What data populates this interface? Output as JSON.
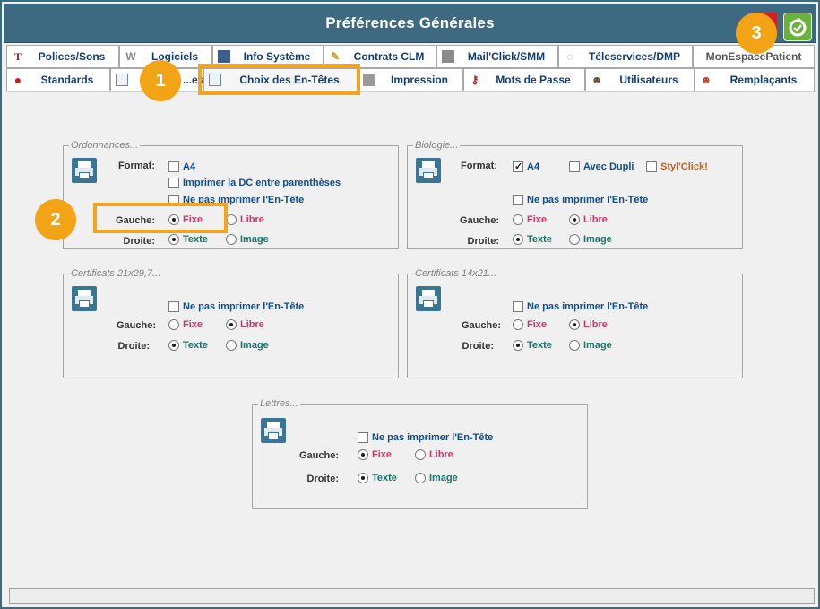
{
  "window": {
    "title": "Préférences Générales"
  },
  "tabs_row1": [
    {
      "label": "Polices/Sons",
      "icon": "font-icon"
    },
    {
      "label": "Logiciels",
      "icon": "logiciels-icon"
    },
    {
      "label": "Info Système",
      "icon": "system-info-icon"
    },
    {
      "label": "Contrats CLM",
      "icon": "pencil-icon"
    },
    {
      "label": "Mail'Click/SMM",
      "icon": "mail-icon"
    },
    {
      "label": "Téleservices/DMP",
      "icon": "teleservices-icon"
    },
    {
      "label": "MonEspacePatient",
      "icon": ""
    }
  ],
  "tabs_row2": [
    {
      "label": "Standards",
      "icon": "red-dot-icon"
    },
    {
      "label": "...es",
      "icon": "edit-icon"
    },
    {
      "label": "Choix des En-Têtes",
      "icon": "header-edit-icon",
      "active": true
    },
    {
      "label": "Impression",
      "icon": "printer-icon"
    },
    {
      "label": "Mots de Passe",
      "icon": "key-icon"
    },
    {
      "label": "Utilisateurs",
      "icon": "user-icon"
    },
    {
      "label": "Remplaçants",
      "icon": "replacement-user-icon"
    }
  ],
  "labels": {
    "format": "Format:",
    "gauche": "Gauche:",
    "droite": "Droite:",
    "fixe": "Fixe",
    "libre": "Libre",
    "texte": "Texte",
    "image": "Image",
    "no_header": "Ne pas imprimer l'En-Tête"
  },
  "ordonnances": {
    "legend": "Ordonnances...",
    "a4": "A4",
    "dc": "Imprimer la DC entre parenthèses",
    "a4_checked": false,
    "dc_checked": false,
    "no_header_checked": false,
    "gauche": "Fixe",
    "droite": "Texte"
  },
  "biologie": {
    "legend": "Biologie...",
    "a4": "A4",
    "avec_dupli": "Avec Dupli",
    "styl_click": "Styl'Click!",
    "a4_checked": true,
    "avec_dupli_checked": false,
    "styl_click_checked": false,
    "no_header_checked": false,
    "gauche": "Libre",
    "droite": "Texte"
  },
  "certif_21": {
    "legend": "Certificats 21x29,7...",
    "no_header_checked": false,
    "gauche": "Libre",
    "droite": "Texte"
  },
  "certif_14": {
    "legend": "Certificats 14x21...",
    "no_header_checked": false,
    "gauche": "Libre",
    "droite": "Texte"
  },
  "lettres": {
    "legend": "Lettres...",
    "no_header_checked": false,
    "gauche": "Fixe",
    "droite": "Texte"
  },
  "annotations": {
    "badge1": "1",
    "badge2": "2",
    "badge3": "3",
    "color": "#f2a316"
  },
  "colors": {
    "title_bar": "#3d6a80",
    "highlight": "#f4a31c"
  }
}
